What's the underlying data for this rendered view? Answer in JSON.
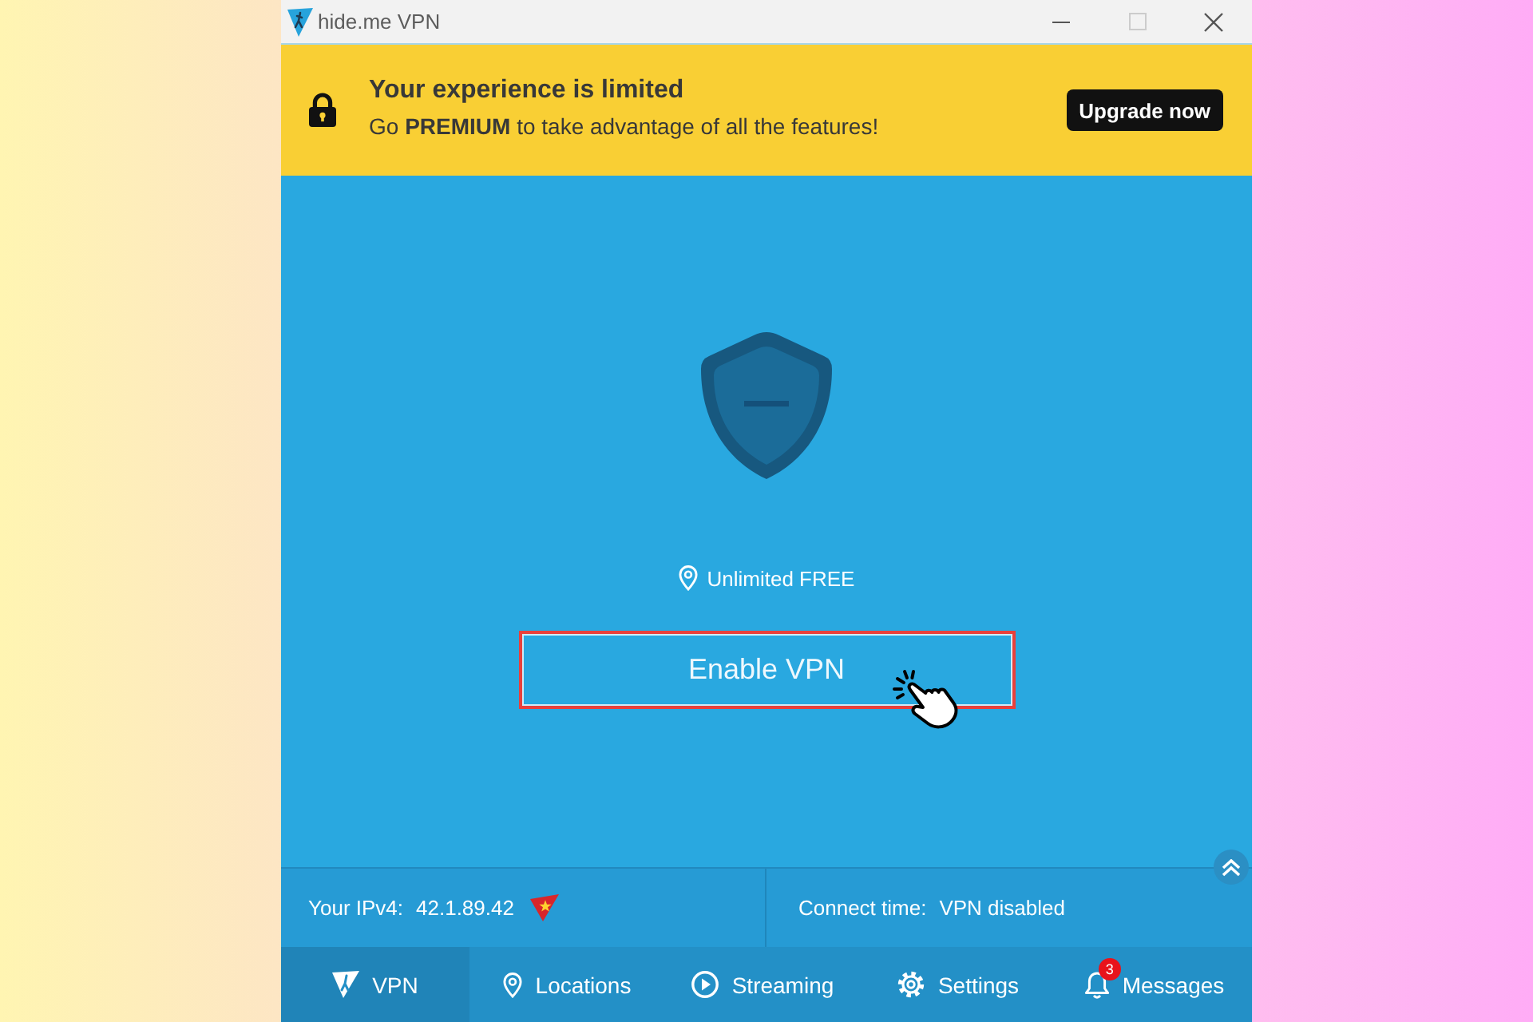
{
  "window": {
    "title": "hide.me VPN",
    "maximize_disabled": true
  },
  "banner": {
    "title": "Your experience is limited",
    "text": "Go **PREMIUM** to take advantage of all the features!",
    "button": "Upgrade now"
  },
  "status": {
    "connected": false,
    "location": "Unlimited FREE",
    "button": "Enable VPN",
    "highlighted": true
  },
  "info": {
    "ip_label": "Your IPv4:",
    "ip": "42.1.89.42",
    "connect_label": "Connect time:",
    "connect_value": "VPN disabled"
  },
  "nav": [
    {
      "kind": "vpn",
      "label": "VPN",
      "selected": true
    },
    {
      "kind": "locations",
      "label": "Locations",
      "selected": false
    },
    {
      "kind": "streaming",
      "label": "Streaming",
      "selected": false
    },
    {
      "kind": "settings",
      "label": "Settings",
      "selected": false
    },
    {
      "kind": "messages",
      "label": "Messages",
      "selected": false,
      "badge": "3"
    }
  ]
}
